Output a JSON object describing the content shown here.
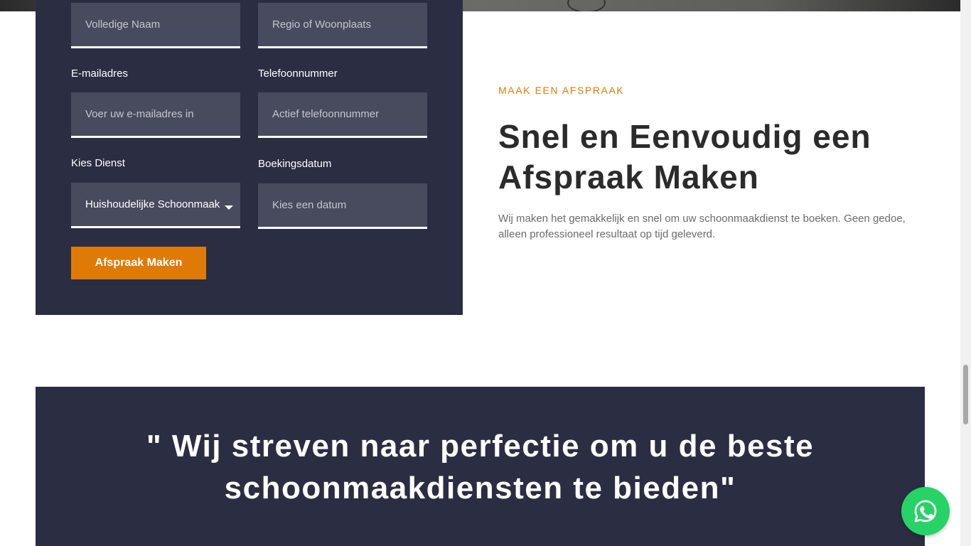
{
  "form": {
    "full_name_placeholder": "Volledige Naam",
    "region_placeholder": "Regio of Woonplaats",
    "email_label": "E-mailadres",
    "email_placeholder": "Voer uw e-mailadres in",
    "phone_label": "Telefoonnummer",
    "phone_placeholder": "Actief telefoonnummer",
    "service_label": "Kies Dienst",
    "service_value": "Huishoudelijke Schoonmaak",
    "date_label": "Boekingsdatum",
    "date_placeholder": "Kies een datum",
    "submit_label": "Afspraak Maken"
  },
  "intro": {
    "eyebrow": "MAAK EEN AFSPRAAK",
    "heading": "Snel en Eenvoudig een Afspraak Maken",
    "description": "Wij maken het gemakkelijk en snel om uw schoonmaakdienst te boeken. Geen gedoe, alleen professioneel resultaat op tijd geleverd."
  },
  "quote": {
    "text": "\" Wij streven naar perfectie om u de beste schoonmaakdiensten te bieden\""
  },
  "icons": {
    "chat_widget": "whatsapp-icon",
    "select_arrow": "chevron-down-icon"
  },
  "colors": {
    "panel": "#2b2d42",
    "accent": "#e07a07",
    "whatsapp": "#25d366"
  }
}
